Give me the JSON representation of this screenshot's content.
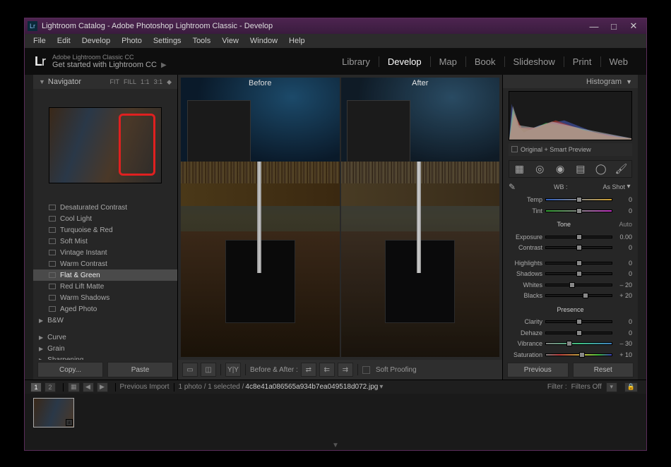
{
  "window": {
    "title": "Lightroom Catalog - Adobe Photoshop Lightroom Classic - Develop"
  },
  "menu": [
    "File",
    "Edit",
    "Develop",
    "Photo",
    "Settings",
    "Tools",
    "View",
    "Window",
    "Help"
  ],
  "header": {
    "logo": "Lr",
    "sub1": "Adobe Lightroom Classic CC",
    "sub2": "Get started with Lightroom CC",
    "modules": [
      "Library",
      "Develop",
      "Map",
      "Book",
      "Slideshow",
      "Print",
      "Web"
    ],
    "active_module": "Develop"
  },
  "navigator": {
    "title": "Navigator",
    "zoom": [
      "FIT",
      "FILL",
      "1:1",
      "3:1"
    ]
  },
  "presets": {
    "items": [
      "Desaturated Contrast",
      "Cool Light",
      "Turquoise & Red",
      "Soft Mist",
      "Vintage Instant",
      "Warm Contrast",
      "Flat & Green",
      "Red Lift Matte",
      "Warm Shadows",
      "Aged Photo"
    ],
    "selected": "Flat & Green",
    "groups": [
      "B&W",
      "Curve",
      "Grain",
      "Sharpening"
    ]
  },
  "left_buttons": {
    "copy": "Copy...",
    "paste": "Paste"
  },
  "compare": {
    "before": "Before",
    "after": "After"
  },
  "center_toolbar": {
    "before_after": "Before & After :",
    "soft_proof": "Soft Proofing"
  },
  "right": {
    "histogram": "Histogram",
    "preview_mode": "Original + Smart Preview",
    "wb_label": "WB :",
    "wb_value": "As Shot",
    "tone": "Tone",
    "auto": "Auto",
    "presence": "Presence",
    "sliders": {
      "temp": {
        "label": "Temp",
        "value": "0",
        "pos": 50
      },
      "tint": {
        "label": "Tint",
        "value": "0",
        "pos": 50
      },
      "exposure": {
        "label": "Exposure",
        "value": "0.00",
        "pos": 50
      },
      "contrast": {
        "label": "Contrast",
        "value": "0",
        "pos": 50
      },
      "highlights": {
        "label": "Highlights",
        "value": "0",
        "pos": 50
      },
      "shadows": {
        "label": "Shadows",
        "value": "0",
        "pos": 50
      },
      "whites": {
        "label": "Whites",
        "value": "– 20",
        "pos": 40
      },
      "blacks": {
        "label": "Blacks",
        "value": "+ 20",
        "pos": 60
      },
      "clarity": {
        "label": "Clarity",
        "value": "0",
        "pos": 50
      },
      "dehaze": {
        "label": "Dehaze",
        "value": "0",
        "pos": 50
      },
      "vibrance": {
        "label": "Vibrance",
        "value": "– 30",
        "pos": 35
      },
      "saturation": {
        "label": "Saturation",
        "value": "+ 10",
        "pos": 55
      }
    },
    "buttons": {
      "previous": "Previous",
      "reset": "Reset"
    }
  },
  "filmstrip": {
    "pages": [
      "1",
      "2"
    ],
    "source": "Previous Import",
    "count": "1 photo / 1 selected /",
    "filename": "4c8e41a086565a934b7ea049518d072.jpg",
    "filter_label": "Filter :",
    "filter_value": "Filters Off"
  }
}
